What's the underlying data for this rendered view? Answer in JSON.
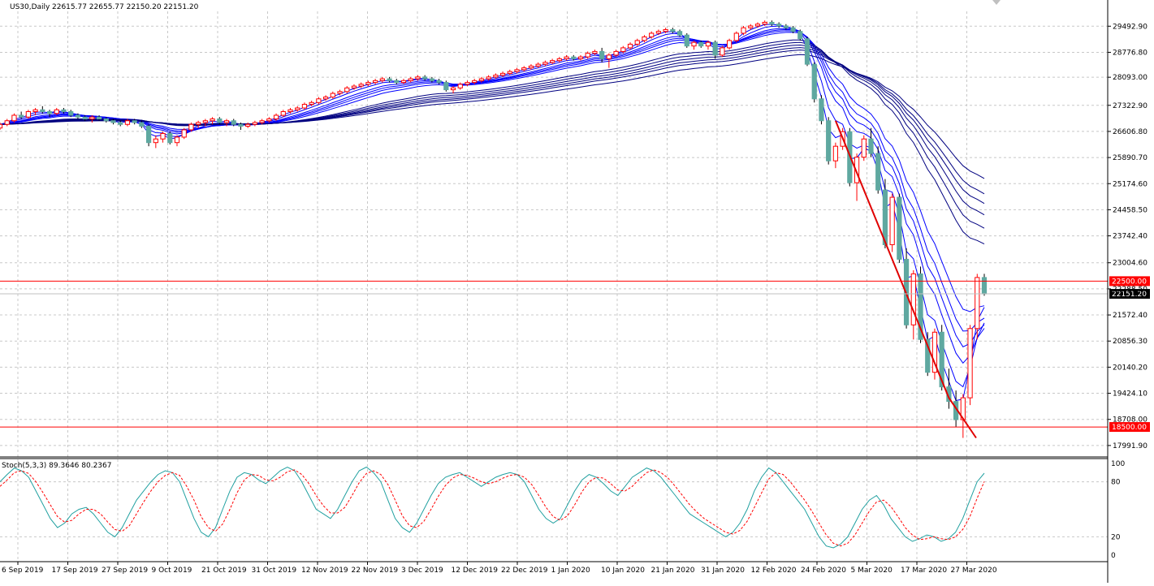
{
  "header": {
    "symbol_timeframe": "US30,Daily",
    "ohlc": "22615.77 22655.77 22150.20 22151.20"
  },
  "stoch_header": "Stoch(5,3,3) 89.3646 80.2367",
  "colors": {
    "background": "#ffffff",
    "grid": "#c8c8c8",
    "candle_up": "#ff0000",
    "candle_down": "#5fa8a0",
    "fast_ma": "#0000ff",
    "slow_ma": "#000080",
    "level_line": "#ff0000",
    "trend_line": "#e00000",
    "stoch_main": "#20a0a0",
    "stoch_signal": "#ff0000",
    "level_label_bg": "#ff0000",
    "current_label_bg": "#000000"
  },
  "chart_data": [
    {
      "type": "candlestick",
      "title": "US30,Daily",
      "ylim": [
        17700,
        29900
      ],
      "price_ticks": [
        "29492.90",
        "28776.80",
        "28093.00",
        "27322.90",
        "26606.80",
        "25890.70",
        "25174.60",
        "24458.50",
        "23742.40",
        "23004.60",
        "22288.50",
        "21572.40",
        "20856.30",
        "20140.20",
        "19424.10",
        "18708.00",
        "17991.90"
      ],
      "x_labels": [
        "6 Sep 2019",
        "17 Sep 2019",
        "27 Sep 2019",
        "9 Oct 2019",
        "21 Oct 2019",
        "31 Oct 2019",
        "12 Nov 2019",
        "22 Nov 2019",
        "3 Dec 2019",
        "12 Dec 2019",
        "22 Dec 2019",
        "1 Jan 2020",
        "10 Jan 2020",
        "21 Jan 2020",
        "31 Jan 2020",
        "12 Feb 2020",
        "24 Feb 2020",
        "5 Mar 2020",
        "17 Mar 2020",
        "27 Mar 2020"
      ],
      "horizontal_levels": [
        {
          "value": 22500,
          "label": "22500.00"
        },
        {
          "value": 18500,
          "label": "18500.00"
        }
      ],
      "current_price": {
        "value": 22151.2,
        "label": "22151.20"
      },
      "candles": [
        [
          26700,
          26850,
          26650,
          26800
        ],
        [
          26800,
          26950,
          26750,
          26900
        ],
        [
          26900,
          27100,
          26850,
          27050
        ],
        [
          27050,
          27150,
          26950,
          27000
        ],
        [
          27000,
          27200,
          26950,
          27150
        ],
        [
          27150,
          27250,
          27050,
          27200
        ],
        [
          27200,
          27300,
          27100,
          27150
        ],
        [
          27150,
          27200,
          27000,
          27100
        ],
        [
          27100,
          27250,
          27050,
          27200
        ],
        [
          27200,
          27250,
          27100,
          27150
        ],
        [
          27150,
          27200,
          27000,
          27050
        ],
        [
          27050,
          27100,
          26950,
          27000
        ],
        [
          27000,
          27050,
          26900,
          26950
        ],
        [
          26950,
          27050,
          26850,
          27000
        ],
        [
          27000,
          27050,
          26900,
          26950
        ],
        [
          26950,
          27000,
          26850,
          26900
        ],
        [
          26900,
          26950,
          26800,
          26850
        ],
        [
          26850,
          26900,
          26750,
          26800
        ],
        [
          26800,
          26950,
          26750,
          26900
        ],
        [
          26900,
          26950,
          26800,
          26850
        ],
        [
          26850,
          26900,
          26700,
          26750
        ],
        [
          26750,
          26800,
          26200,
          26300
        ],
        [
          26300,
          26500,
          26150,
          26400
        ],
        [
          26400,
          26600,
          26300,
          26550
        ],
        [
          26550,
          26600,
          26250,
          26300
        ],
        [
          26300,
          26500,
          26200,
          26450
        ],
        [
          26450,
          26700,
          26400,
          26650
        ],
        [
          26650,
          26850,
          26600,
          26800
        ],
        [
          26800,
          26900,
          26700,
          26850
        ],
        [
          26850,
          26950,
          26750,
          26900
        ],
        [
          26900,
          27000,
          26800,
          26950
        ],
        [
          26950,
          27000,
          26800,
          26850
        ],
        [
          26850,
          26950,
          26750,
          26900
        ],
        [
          26900,
          26950,
          26750,
          26800
        ],
        [
          26800,
          26850,
          26650,
          26750
        ],
        [
          26750,
          26850,
          26700,
          26800
        ],
        [
          26800,
          26900,
          26750,
          26850
        ],
        [
          26850,
          26950,
          26800,
          26900
        ],
        [
          26900,
          27000,
          26850,
          26950
        ],
        [
          26950,
          27100,
          26900,
          27050
        ],
        [
          27050,
          27200,
          27000,
          27150
        ],
        [
          27150,
          27250,
          27100,
          27200
        ],
        [
          27200,
          27300,
          27150,
          27250
        ],
        [
          27250,
          27400,
          27200,
          27350
        ],
        [
          27350,
          27450,
          27300,
          27400
        ],
        [
          27400,
          27550,
          27350,
          27500
        ],
        [
          27500,
          27600,
          27450,
          27550
        ],
        [
          27550,
          27700,
          27500,
          27650
        ],
        [
          27650,
          27750,
          27600,
          27700
        ],
        [
          27700,
          27850,
          27650,
          27800
        ],
        [
          27800,
          27900,
          27750,
          27850
        ],
        [
          27850,
          27950,
          27800,
          27900
        ],
        [
          27900,
          28000,
          27850,
          27950
        ],
        [
          27950,
          28050,
          27900,
          28000
        ],
        [
          28000,
          28100,
          27950,
          28050
        ],
        [
          28050,
          28100,
          27950,
          28000
        ],
        [
          28000,
          28050,
          27900,
          27950
        ],
        [
          27950,
          28050,
          27900,
          28000
        ],
        [
          28000,
          28100,
          27950,
          28050
        ],
        [
          28050,
          28150,
          28000,
          28100
        ],
        [
          28100,
          28150,
          28000,
          28050
        ],
        [
          28050,
          28100,
          27950,
          28000
        ],
        [
          28000,
          28050,
          27900,
          27950
        ],
        [
          27950,
          28000,
          27700,
          27750
        ],
        [
          27750,
          27850,
          27650,
          27800
        ],
        [
          27800,
          27950,
          27750,
          27900
        ],
        [
          27900,
          28000,
          27850,
          27950
        ],
        [
          27950,
          28050,
          27900,
          28000
        ],
        [
          28000,
          28100,
          27950,
          28050
        ],
        [
          28050,
          28150,
          28000,
          28100
        ],
        [
          28100,
          28200,
          28050,
          28150
        ],
        [
          28150,
          28250,
          28100,
          28200
        ],
        [
          28200,
          28300,
          28150,
          28250
        ],
        [
          28250,
          28350,
          28200,
          28300
        ],
        [
          28300,
          28400,
          28250,
          28350
        ],
        [
          28350,
          28450,
          28300,
          28400
        ],
        [
          28400,
          28500,
          28350,
          28450
        ],
        [
          28450,
          28550,
          28400,
          28500
        ],
        [
          28500,
          28600,
          28450,
          28550
        ],
        [
          28550,
          28650,
          28500,
          28600
        ],
        [
          28600,
          28700,
          28550,
          28650
        ],
        [
          28650,
          28700,
          28550,
          28600
        ],
        [
          28600,
          28700,
          28550,
          28650
        ],
        [
          28650,
          28800,
          28600,
          28750
        ],
        [
          28750,
          28850,
          28700,
          28800
        ],
        [
          28800,
          28900,
          28500,
          28600
        ],
        [
          28600,
          28750,
          28350,
          28700
        ],
        [
          28700,
          28850,
          28650,
          28800
        ],
        [
          28800,
          28950,
          28750,
          28900
        ],
        [
          28900,
          29050,
          28850,
          29000
        ],
        [
          29000,
          29150,
          28950,
          29100
        ],
        [
          29100,
          29250,
          29050,
          29200
        ],
        [
          29200,
          29350,
          29150,
          29300
        ],
        [
          29300,
          29400,
          29250,
          29350
        ],
        [
          29350,
          29450,
          29300,
          29400
        ],
        [
          29400,
          29450,
          29300,
          29350
        ],
        [
          29350,
          29400,
          29200,
          29250
        ],
        [
          29250,
          29300,
          28900,
          28950
        ],
        [
          28950,
          29100,
          28850,
          29050
        ],
        [
          29050,
          29100,
          28900,
          28950
        ],
        [
          28950,
          29100,
          28850,
          29050
        ],
        [
          29050,
          29100,
          28600,
          28700
        ],
        [
          28700,
          28950,
          28650,
          28900
        ],
        [
          28900,
          29150,
          28850,
          29100
        ],
        [
          29100,
          29350,
          29050,
          29300
        ],
        [
          29300,
          29500,
          29250,
          29450
        ],
        [
          29450,
          29550,
          29400,
          29500
        ],
        [
          29500,
          29600,
          29450,
          29550
        ],
        [
          29550,
          29650,
          29500,
          29600
        ],
        [
          29600,
          29650,
          29500,
          29550
        ],
        [
          29550,
          29600,
          29450,
          29500
        ],
        [
          29500,
          29550,
          29400,
          29450
        ],
        [
          29450,
          29500,
          29300,
          29350
        ],
        [
          29350,
          29400,
          29100,
          29150
        ],
        [
          29150,
          29200,
          28400,
          28450
        ],
        [
          28450,
          28500,
          27400,
          27500
        ],
        [
          27500,
          27600,
          26800,
          26900
        ],
        [
          26900,
          27000,
          25700,
          25800
        ],
        [
          25800,
          26300,
          25600,
          26200
        ],
        [
          26200,
          26700,
          26100,
          26600
        ],
        [
          26600,
          26700,
          25100,
          25200
        ],
        [
          25200,
          26000,
          24700,
          25900
        ],
        [
          25900,
          26500,
          25800,
          26400
        ],
        [
          26400,
          26700,
          25900,
          26000
        ],
        [
          26000,
          26200,
          24900,
          25000
        ],
        [
          25000,
          25300,
          23400,
          23500
        ],
        [
          23500,
          24900,
          23300,
          24800
        ],
        [
          24800,
          24900,
          23000,
          23100
        ],
        [
          23100,
          23400,
          21200,
          21300
        ],
        [
          21300,
          22800,
          20900,
          22700
        ],
        [
          22700,
          22900,
          20800,
          20900
        ],
        [
          20900,
          21100,
          19900,
          20000
        ],
        [
          20000,
          21200,
          19800,
          21100
        ],
        [
          21100,
          21300,
          19500,
          19600
        ],
        [
          19600,
          20100,
          19000,
          19200
        ],
        [
          19200,
          19500,
          18500,
          18700
        ],
        [
          18700,
          19400,
          18200,
          19300
        ],
        [
          19300,
          21300,
          19100,
          21200
        ],
        [
          21200,
          22700,
          20900,
          22600
        ],
        [
          22600,
          22700,
          22100,
          22150
        ]
      ],
      "series": [
        {
          "name": "",
          "values": []
        }
      ]
    },
    {
      "type": "line",
      "title": "Stoch(5,3,3) 89.3646 80.2367",
      "ylim": [
        0,
        100
      ],
      "y_ticks": [
        "100",
        "80",
        "20",
        "0"
      ],
      "series": [
        {
          "name": "main",
          "values": [
            80,
            88,
            95,
            92,
            85,
            70,
            55,
            40,
            30,
            35,
            45,
            50,
            52,
            45,
            35,
            25,
            20,
            30,
            45,
            60,
            70,
            80,
            88,
            92,
            90,
            80,
            60,
            40,
            25,
            20,
            30,
            50,
            70,
            85,
            90,
            88,
            82,
            78,
            85,
            92,
            96,
            92,
            80,
            65,
            50,
            45,
            40,
            50,
            65,
            80,
            92,
            96,
            90,
            80,
            60,
            40,
            30,
            25,
            35,
            50,
            65,
            78,
            85,
            88,
            90,
            85,
            80,
            75,
            80,
            85,
            88,
            90,
            88,
            80,
            65,
            50,
            40,
            35,
            40,
            55,
            70,
            82,
            88,
            85,
            78,
            70,
            65,
            75,
            85,
            90,
            95,
            92,
            85,
            75,
            65,
            55,
            45,
            40,
            35,
            30,
            25,
            20,
            25,
            35,
            50,
            70,
            85,
            95,
            90,
            80,
            70,
            60,
            50,
            35,
            20,
            10,
            8,
            12,
            20,
            35,
            50,
            60,
            65,
            55,
            40,
            30,
            20,
            15,
            18,
            22,
            20,
            15,
            18,
            25,
            40,
            60,
            80,
            89.36
          ]
        },
        {
          "name": "signal",
          "values": [
            75,
            82,
            90,
            92,
            89,
            80,
            68,
            55,
            42,
            36,
            38,
            45,
            50,
            50,
            45,
            36,
            28,
            26,
            32,
            45,
            58,
            70,
            80,
            87,
            90,
            87,
            75,
            60,
            42,
            30,
            26,
            34,
            50,
            68,
            82,
            88,
            87,
            82,
            81,
            85,
            91,
            93,
            88,
            78,
            65,
            54,
            46,
            46,
            52,
            65,
            79,
            89,
            92,
            88,
            77,
            60,
            43,
            32,
            30,
            37,
            50,
            64,
            76,
            84,
            88,
            87,
            84,
            80,
            78,
            80,
            84,
            87,
            88,
            85,
            77,
            65,
            52,
            42,
            38,
            43,
            55,
            69,
            80,
            85,
            84,
            78,
            71,
            70,
            75,
            83,
            90,
            93,
            90,
            84,
            75,
            65,
            55,
            47,
            40,
            35,
            30,
            25,
            23,
            27,
            37,
            52,
            68,
            83,
            90,
            88,
            80,
            70,
            60,
            48,
            35,
            22,
            13,
            10,
            13,
            22,
            35,
            48,
            58,
            60,
            53,
            42,
            30,
            22,
            17,
            18,
            20,
            18,
            17,
            20,
            28,
            42,
            62,
            80.24
          ]
        }
      ]
    }
  ]
}
